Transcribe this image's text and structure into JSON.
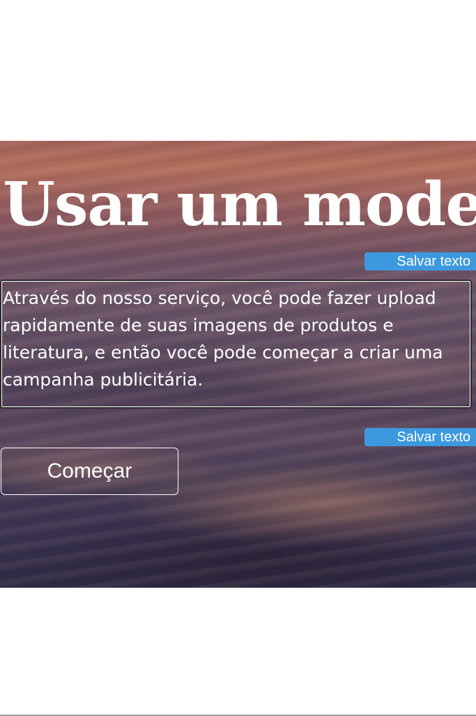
{
  "hero": {
    "title": "Usar um mode",
    "save_text_label_1": "Salvar texto",
    "description": "Através do nosso serviço, você pode fazer upload rapidamente de suas imagens de produtos e literatura, e então você pode começar a criar uma campanha publicitária.",
    "save_text_label_2": "Salvar texto",
    "start_button": "Começar"
  },
  "colors": {
    "save_button_bg": "#3d99df",
    "text": "#ffffff"
  }
}
